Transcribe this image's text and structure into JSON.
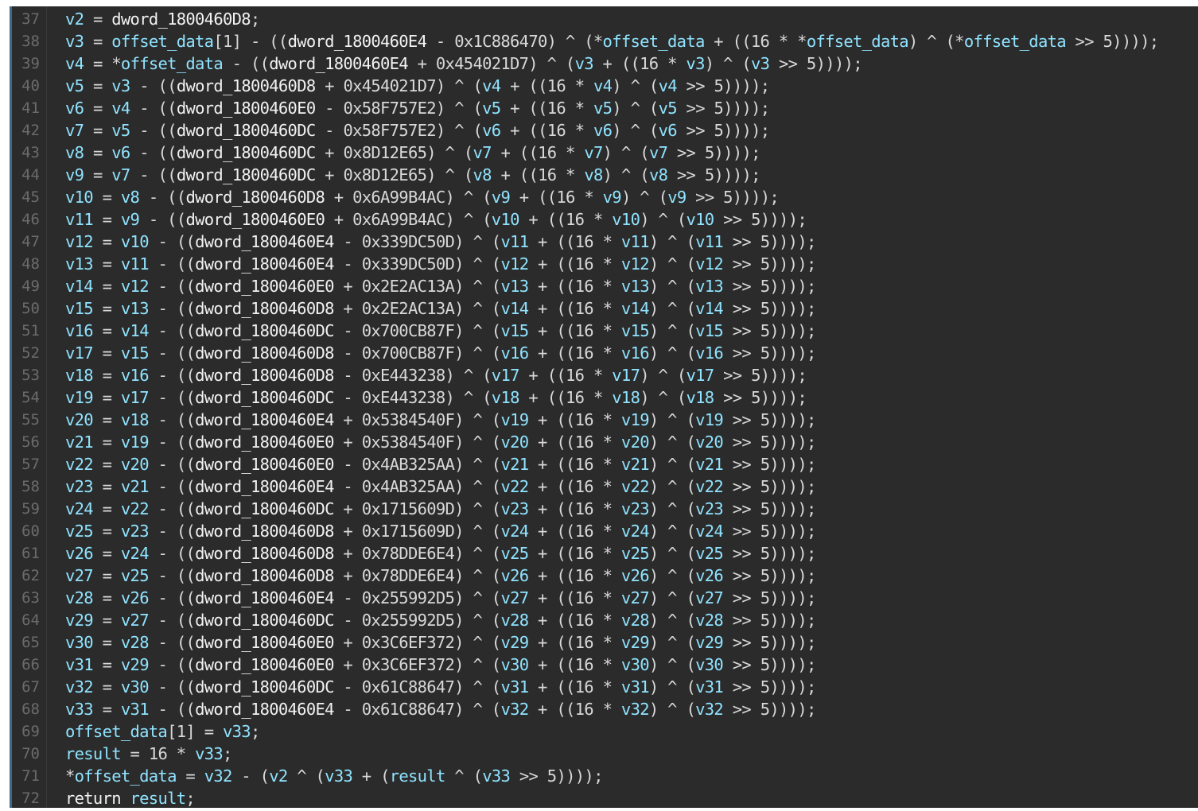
{
  "colors": {
    "background": "#2b2b2b",
    "variable": "#8fe3ff",
    "global": "#f2f2f2",
    "line_number": "#6b6b6b"
  },
  "lines": [
    {
      "n": "37",
      "code": "v2 = dword_1800460D8;"
    },
    {
      "n": "38",
      "code": "v3 = offset_data[1] - ((dword_1800460E4 - 0x1C886470) ^ (*offset_data + ((16 * *offset_data) ^ (*offset_data >> 5))));"
    },
    {
      "n": "39",
      "code": "v4 = *offset_data - ((dword_1800460E4 + 0x454021D7) ^ (v3 + ((16 * v3) ^ (v3 >> 5))));"
    },
    {
      "n": "40",
      "code": "v5 = v3 - ((dword_1800460D8 + 0x454021D7) ^ (v4 + ((16 * v4) ^ (v4 >> 5))));"
    },
    {
      "n": "41",
      "code": "v6 = v4 - ((dword_1800460E0 - 0x58F757E2) ^ (v5 + ((16 * v5) ^ (v5 >> 5))));"
    },
    {
      "n": "42",
      "code": "v7 = v5 - ((dword_1800460DC - 0x58F757E2) ^ (v6 + ((16 * v6) ^ (v6 >> 5))));"
    },
    {
      "n": "43",
      "code": "v8 = v6 - ((dword_1800460DC + 0x8D12E65) ^ (v7 + ((16 * v7) ^ (v7 >> 5))));"
    },
    {
      "n": "44",
      "code": "v9 = v7 - ((dword_1800460DC + 0x8D12E65) ^ (v8 + ((16 * v8) ^ (v8 >> 5))));"
    },
    {
      "n": "45",
      "code": "v10 = v8 - ((dword_1800460D8 + 0x6A99B4AC) ^ (v9 + ((16 * v9) ^ (v9 >> 5))));"
    },
    {
      "n": "46",
      "code": "v11 = v9 - ((dword_1800460E0 + 0x6A99B4AC) ^ (v10 + ((16 * v10) ^ (v10 >> 5))));"
    },
    {
      "n": "47",
      "code": "v12 = v10 - ((dword_1800460E4 - 0x339DC50D) ^ (v11 + ((16 * v11) ^ (v11 >> 5))));"
    },
    {
      "n": "48",
      "code": "v13 = v11 - ((dword_1800460E4 - 0x339DC50D) ^ (v12 + ((16 * v12) ^ (v12 >> 5))));"
    },
    {
      "n": "49",
      "code": "v14 = v12 - ((dword_1800460E0 + 0x2E2AC13A) ^ (v13 + ((16 * v13) ^ (v13 >> 5))));"
    },
    {
      "n": "50",
      "code": "v15 = v13 - ((dword_1800460D8 + 0x2E2AC13A) ^ (v14 + ((16 * v14) ^ (v14 >> 5))));"
    },
    {
      "n": "51",
      "code": "v16 = v14 - ((dword_1800460DC - 0x700CB87F) ^ (v15 + ((16 * v15) ^ (v15 >> 5))));"
    },
    {
      "n": "52",
      "code": "v17 = v15 - ((dword_1800460D8 - 0x700CB87F) ^ (v16 + ((16 * v16) ^ (v16 >> 5))));"
    },
    {
      "n": "53",
      "code": "v18 = v16 - ((dword_1800460D8 - 0xE443238) ^ (v17 + ((16 * v17) ^ (v17 >> 5))));"
    },
    {
      "n": "54",
      "code": "v19 = v17 - ((dword_1800460DC - 0xE443238) ^ (v18 + ((16 * v18) ^ (v18 >> 5))));"
    },
    {
      "n": "55",
      "code": "v20 = v18 - ((dword_1800460E4 + 0x5384540F) ^ (v19 + ((16 * v19) ^ (v19 >> 5))));"
    },
    {
      "n": "56",
      "code": "v21 = v19 - ((dword_1800460E0 + 0x5384540F) ^ (v20 + ((16 * v20) ^ (v20 >> 5))));"
    },
    {
      "n": "57",
      "code": "v22 = v20 - ((dword_1800460E0 - 0x4AB325AA) ^ (v21 + ((16 * v21) ^ (v21 >> 5))));"
    },
    {
      "n": "58",
      "code": "v23 = v21 - ((dword_1800460E4 - 0x4AB325AA) ^ (v22 + ((16 * v22) ^ (v22 >> 5))));"
    },
    {
      "n": "59",
      "code": "v24 = v22 - ((dword_1800460DC + 0x1715609D) ^ (v23 + ((16 * v23) ^ (v23 >> 5))));"
    },
    {
      "n": "60",
      "code": "v25 = v23 - ((dword_1800460D8 + 0x1715609D) ^ (v24 + ((16 * v24) ^ (v24 >> 5))));"
    },
    {
      "n": "61",
      "code": "v26 = v24 - ((dword_1800460D8 + 0x78DDE6E4) ^ (v25 + ((16 * v25) ^ (v25 >> 5))));"
    },
    {
      "n": "62",
      "code": "v27 = v25 - ((dword_1800460D8 + 0x78DDE6E4) ^ (v26 + ((16 * v26) ^ (v26 >> 5))));"
    },
    {
      "n": "63",
      "code": "v28 = v26 - ((dword_1800460E4 - 0x255992D5) ^ (v27 + ((16 * v27) ^ (v27 >> 5))));"
    },
    {
      "n": "64",
      "code": "v29 = v27 - ((dword_1800460DC - 0x255992D5) ^ (v28 + ((16 * v28) ^ (v28 >> 5))));"
    },
    {
      "n": "65",
      "code": "v30 = v28 - ((dword_1800460E0 + 0x3C6EF372) ^ (v29 + ((16 * v29) ^ (v29 >> 5))));"
    },
    {
      "n": "66",
      "code": "v31 = v29 - ((dword_1800460E0 + 0x3C6EF372) ^ (v30 + ((16 * v30) ^ (v30 >> 5))));"
    },
    {
      "n": "67",
      "code": "v32 = v30 - ((dword_1800460DC - 0x61C88647) ^ (v31 + ((16 * v31) ^ (v31 >> 5))));"
    },
    {
      "n": "68",
      "code": "v33 = v31 - ((dword_1800460E4 - 0x61C88647) ^ (v32 + ((16 * v32) ^ (v32 >> 5))));"
    },
    {
      "n": "69",
      "code": "offset_data[1] = v33;"
    },
    {
      "n": "70",
      "code": "result = 16 * v33;"
    },
    {
      "n": "71",
      "code": "*offset_data = v32 - (v2 ^ (v33 + (result ^ (v33 >> 5))));"
    },
    {
      "n": "72",
      "code": "return result;"
    }
  ]
}
